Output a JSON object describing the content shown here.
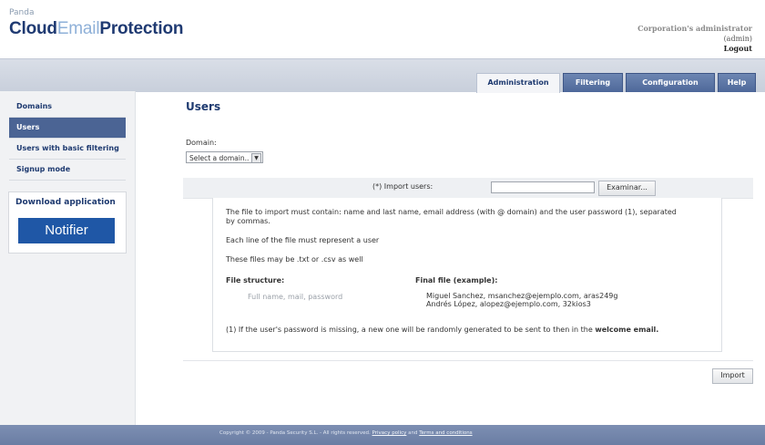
{
  "brand": {
    "small": "Panda",
    "part1": "Cloud",
    "part2": "Email",
    "part3": "Protection"
  },
  "user": {
    "name": "Corporation's administrator",
    "role": "(admin)",
    "logout": "Logout"
  },
  "tabs": [
    {
      "label": "Administration",
      "active": true
    },
    {
      "label": "Filtering",
      "active": false
    },
    {
      "label": "Configuration",
      "active": false
    },
    {
      "label": "Help",
      "active": false
    }
  ],
  "sidebar": {
    "items": [
      {
        "label": "Domains"
      },
      {
        "label": "Users"
      },
      {
        "label": "Users with basic filtering"
      },
      {
        "label": "Signup mode"
      }
    ],
    "download_title": "Download application",
    "notifier_label": "Notifier"
  },
  "main": {
    "title": "Users",
    "domain_label": "Domain:",
    "domain_select": "Select a domain..",
    "import_label": "(*) Import users:",
    "browse_label": "Examinar...",
    "info_line1": "The file to import must contain: name and last name, email address (with @ domain) and the user password (1), separated",
    "info_line1b": "by commas.",
    "info_line2": "Each line of the file must represent a user",
    "info_line3": "These files may be .txt or .csv as well",
    "structure_head": "File structure:",
    "structure_value": "Full name, mail, password",
    "final_head": "Final file (example):",
    "example1": "Miguel Sanchez, msanchez@ejemplo.com, aras249g",
    "example2": "Andrés López, alopez@ejemplo.com, 32kios3",
    "note_pre": "(1) If the user's password is missing, a new one will be randomly generated to be sent to then in the ",
    "note_bold": "welcome email.",
    "import_button": "Import"
  },
  "footer": {
    "text": "Copyright © 2009 - Panda Security S.L. - All rights reserved.",
    "privacy": "Privacy policy",
    "and": "and",
    "terms": "Terms and conditions"
  },
  "colors": {
    "accent": "#1e3a70",
    "tab": "#4e689a",
    "footer": "#6a7da3",
    "notifier": "#1f57a6"
  }
}
